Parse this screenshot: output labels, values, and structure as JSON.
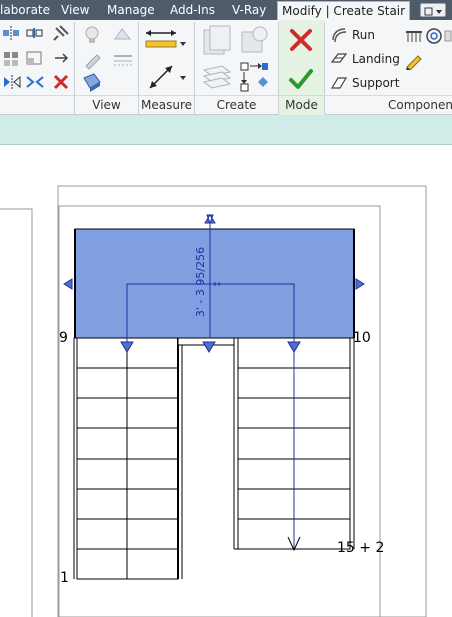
{
  "tabs": [
    {
      "label": "laborate",
      "active": false
    },
    {
      "label": "View",
      "active": false
    },
    {
      "label": "Manage",
      "active": false
    },
    {
      "label": "Add-Ins",
      "active": false
    },
    {
      "label": "V-Ray",
      "active": false
    },
    {
      "label": "Modify | Create Stair",
      "active": true
    }
  ],
  "panels": {
    "view": "View",
    "measure": "Measure",
    "create": "Create",
    "mode": "Mode",
    "components": "Componen"
  },
  "components": {
    "run": "Run",
    "landing": "Landing",
    "support": "Support"
  },
  "canvas": {
    "dimension": "3' - 3 95/256",
    "riser_1": "1",
    "riser_9": "9",
    "riser_10": "10",
    "riser_end": "15 + 2"
  },
  "colors": {
    "tabbar": "#4f5b6b",
    "ribbon": "#f4f6f8",
    "mode_panel": "#e6f3e3",
    "strip": "#cfece8",
    "landing_fill": "#7f9fe0",
    "finish_green": "#2e9a2e",
    "cancel_red": "#d12a2a",
    "dimension_blue": "#2030a0"
  },
  "icons": [
    "align-icon",
    "split-icon",
    "pin-icon",
    "array-icon",
    "delete-icon",
    "paint-icon",
    "lightbulb-icon",
    "measure-aligned-icon",
    "measure-angle-icon",
    "create-assembly-icon",
    "create-parts-icon",
    "cancel-icon",
    "finish-icon",
    "run-icon",
    "landing-icon",
    "support-icon",
    "railing-icon",
    "spiral-run-icon",
    "sketch-icon"
  ]
}
